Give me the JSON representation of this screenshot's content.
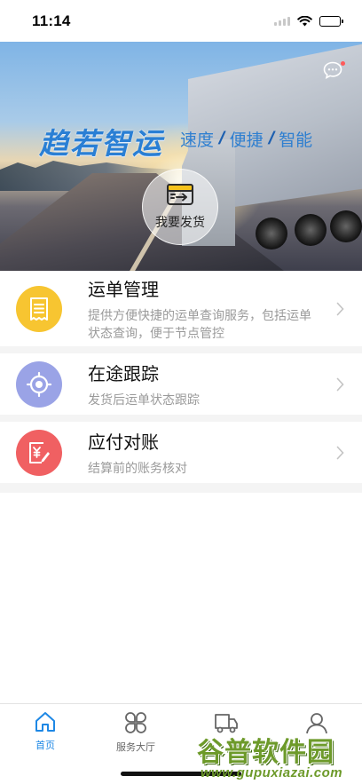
{
  "status_bar": {
    "time": "11:14"
  },
  "banner": {
    "brand": "趋若智运",
    "slogan": [
      "速度",
      "便捷",
      "智能"
    ],
    "slogan_sep": "/",
    "ship_button_label": "我要发货"
  },
  "services": [
    {
      "title": "运单管理",
      "desc": "提供方便快捷的运单查询服务，包括运单状态查询，便于节点管控",
      "icon": "receipt-icon",
      "color": "#f7c531"
    },
    {
      "title": "在途跟踪",
      "desc": "发货后运单状态跟踪",
      "icon": "location-target-icon",
      "color": "#9aa3e6"
    },
    {
      "title": "应付对账",
      "desc": "结算前的账务核对",
      "icon": "yen-invoice-icon",
      "color": "#f06062"
    }
  ],
  "tabbar": {
    "items": [
      {
        "label": "首页",
        "icon": "home-icon",
        "active": true
      },
      {
        "label": "服务大厅",
        "icon": "grid-icon",
        "active": false
      },
      {
        "label": "",
        "icon": "truck-icon",
        "active": false
      },
      {
        "label": "",
        "icon": "user-icon",
        "active": false
      }
    ]
  },
  "colors": {
    "accent": "#1e88e5"
  },
  "watermark": {
    "main": "谷普软件园",
    "sub": "www.gupuxiazai.com"
  }
}
